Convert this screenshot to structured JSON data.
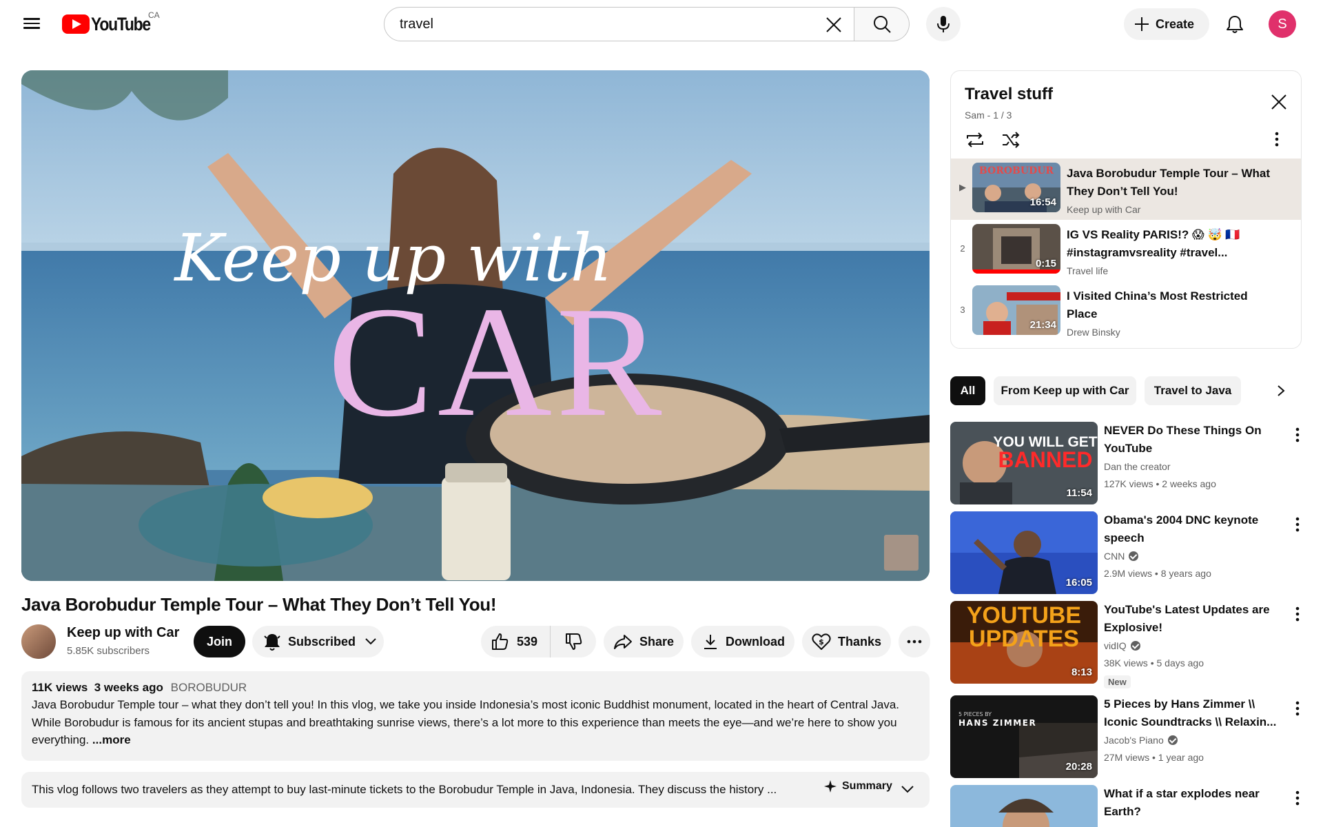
{
  "header": {
    "logo_text": "YouTube",
    "country": "CA",
    "search_value": "travel",
    "create_label": "Create",
    "avatar_letter": "S"
  },
  "player": {
    "overlay_script": "Keep up with",
    "overlay_big": "CAR"
  },
  "video": {
    "title": "Java Borobudur Temple Tour – What They Don’t Tell You!",
    "channel": "Keep up with Car",
    "subscribers": "5.85K subscribers",
    "join_label": "Join",
    "subscribed_label": "Subscribed",
    "like_count": "539",
    "share_label": "Share",
    "download_label": "Download",
    "thanks_label": "Thanks"
  },
  "description": {
    "views": "11K views",
    "age": "3 weeks ago",
    "tag": "BOROBUDUR",
    "text": "Java Borobudur Temple tour – what they don’t tell you! In this vlog, we take you inside Indonesia’s most iconic Buddhist monument, located in the heart of Central Java. While Borobudur is famous for its ancient stupas and breathtaking sunrise views, there’s a lot more to this experience than meets the eye—and we’re here to show you everything.",
    "more_label": "...more"
  },
  "summary": {
    "text": "This vlog follows two travelers as they attempt to buy last-minute tickets to the Borobudur Temple in Java, Indonesia. They discuss the history ...",
    "button_label": "Summary"
  },
  "playlist": {
    "title": "Travel stuff",
    "subtitle": "Sam - 1 / 3",
    "items": [
      {
        "index": "▶",
        "title": "Java Borobudur Temple Tour – What They Don’t Tell You!",
        "channel": "Keep up with Car",
        "duration": "16:54",
        "thumb_text": "BOROBUDUR"
      },
      {
        "index": "2",
        "title": "IG VS Reality PARIS!? 😱 🤯 🇫🇷 #instagramvsreality #travel...",
        "channel": "Travel life",
        "duration": "0:15"
      },
      {
        "index": "3",
        "title": "I Visited China’s Most Restricted Place",
        "channel": "Drew Binsky",
        "duration": "21:34"
      }
    ]
  },
  "chips": [
    "All",
    "From Keep up with Car",
    "Travel to Java"
  ],
  "recommendations": [
    {
      "title": "NEVER Do These Things On YouTube",
      "channel": "Dan the creator",
      "verified": false,
      "meta": "127K views • 2 weeks ago",
      "duration": "11:54",
      "thumb_line1": "YOU WILL GET",
      "thumb_line2": "BANNED"
    },
    {
      "title": "Obama's 2004 DNC keynote speech",
      "channel": "CNN",
      "verified": true,
      "meta": "2.9M views • 8 years ago",
      "duration": "16:05"
    },
    {
      "title": "YouTube's Latest Updates are Explosive!",
      "channel": "vidIQ",
      "verified": true,
      "meta": "38K views • 5 days ago",
      "duration": "8:13",
      "badge": "New",
      "thumb_line1": "YOUTUBE",
      "thumb_line2": "UPDATES"
    },
    {
      "title": "5 Pieces by Hans Zimmer \\\\ Iconic Soundtracks \\\\ Relaxin...",
      "channel": "Jacob's Piano",
      "verified": true,
      "meta": "27M views • 1 year ago",
      "duration": "20:28",
      "thumb_line1": "5 PIECES BY",
      "thumb_line2": "HANS ZIMMER"
    },
    {
      "title": "What if a star explodes near Earth?",
      "channel": "",
      "verified": false,
      "meta": "",
      "duration": ""
    }
  ],
  "colors": {
    "brand_red": "#ff0000",
    "avatar_pink": "#e0306b",
    "chip_dark": "#0f0f0f",
    "overlay_pink": "#e9b6e6"
  },
  "icons": [
    "menu-icon",
    "clear-icon",
    "search-icon",
    "mic-icon",
    "plus-icon",
    "bell-icon",
    "bell-ring-icon",
    "chevron-down-icon",
    "thumb-up-icon",
    "thumb-down-icon",
    "share-icon",
    "download-icon",
    "heart-dollar-icon",
    "more-horizontal-icon",
    "sparkle-icon",
    "close-icon",
    "loop-icon",
    "shuffle-icon",
    "more-vertical-icon",
    "chevron-right-icon",
    "verified-icon"
  ]
}
